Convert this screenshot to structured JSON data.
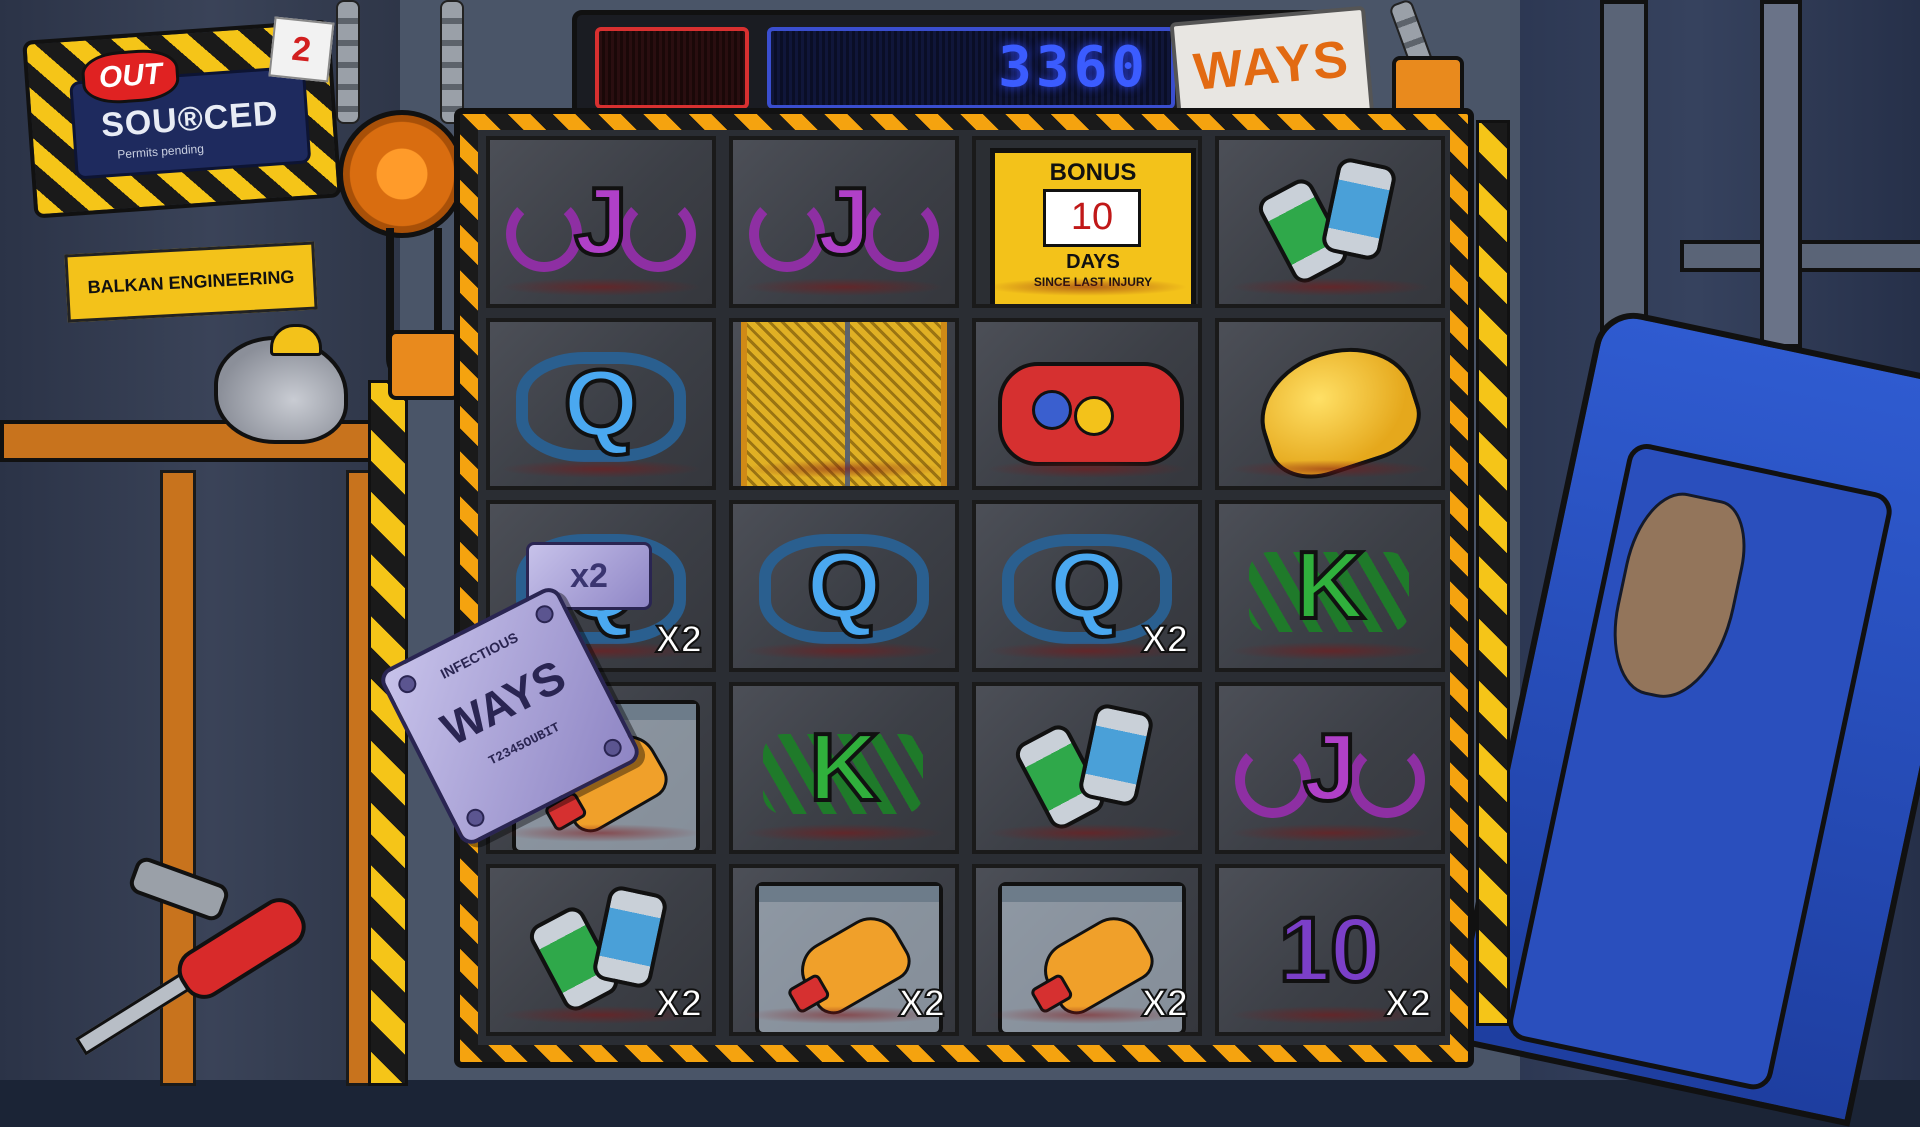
{
  "logo": {
    "out": "OUT",
    "sourced": "SOU®CED",
    "permits": "Permits pending",
    "sequel_number": "2"
  },
  "sign": {
    "balkan": "BALKAN ENGINEERING"
  },
  "topbar": {
    "ways_count": "3360",
    "ways_label": "WAYS"
  },
  "bonus": {
    "title": "BONUS",
    "count": "10",
    "days": "DAYS",
    "since": "SINCE LAST INJURY"
  },
  "ways_plate": {
    "top": "INFECTIOUS",
    "label": "WAYS",
    "code": "T2345OUBIT"
  },
  "grid": {
    "columns": 4,
    "rows": 5,
    "cells": [
      {
        "symbol": "J",
        "multiplier": ""
      },
      {
        "symbol": "J",
        "multiplier": ""
      },
      {
        "symbol": "bonus",
        "multiplier": ""
      },
      {
        "symbol": "cans",
        "multiplier": ""
      },
      {
        "symbol": "Q",
        "multiplier": ""
      },
      {
        "symbol": "grate",
        "multiplier": ""
      },
      {
        "symbol": "gamepad",
        "multiplier": ""
      },
      {
        "symbol": "hardhat",
        "multiplier": ""
      },
      {
        "symbol": "Q",
        "multiplier": "X2",
        "chip": "x2"
      },
      {
        "symbol": "Q",
        "multiplier": ""
      },
      {
        "symbol": "Q",
        "multiplier": "X2"
      },
      {
        "symbol": "K",
        "multiplier": ""
      },
      {
        "symbol": "hand-bag",
        "multiplier": ""
      },
      {
        "symbol": "K",
        "multiplier": ""
      },
      {
        "symbol": "cans",
        "multiplier": ""
      },
      {
        "symbol": "J",
        "multiplier": ""
      },
      {
        "symbol": "cans",
        "multiplier": "X2"
      },
      {
        "symbol": "hand-bag",
        "multiplier": "X2"
      },
      {
        "symbol": "hand-bag",
        "multiplier": "X2"
      },
      {
        "symbol": "10",
        "multiplier": "X2"
      }
    ]
  },
  "colors": {
    "frame_stripe": "#f5a30f",
    "hazard_yellow": "#f5c518",
    "led_blue": "#3b5cff",
    "led_red": "#d83030",
    "ways_orange": "#e26a12"
  }
}
